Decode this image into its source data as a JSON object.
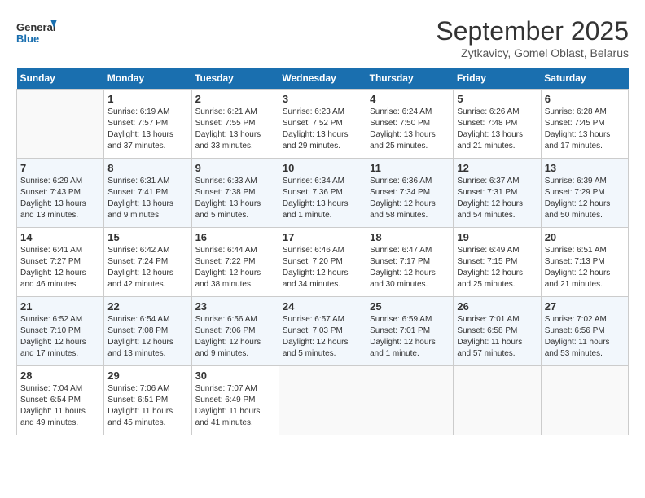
{
  "header": {
    "logo_line1": "General",
    "logo_line2": "Blue",
    "title": "September 2025",
    "subtitle": "Zytkavicy, Gomel Oblast, Belarus"
  },
  "weekdays": [
    "Sunday",
    "Monday",
    "Tuesday",
    "Wednesday",
    "Thursday",
    "Friday",
    "Saturday"
  ],
  "weeks": [
    [
      {
        "day": "",
        "info": ""
      },
      {
        "day": "1",
        "info": "Sunrise: 6:19 AM\nSunset: 7:57 PM\nDaylight: 13 hours\nand 37 minutes."
      },
      {
        "day": "2",
        "info": "Sunrise: 6:21 AM\nSunset: 7:55 PM\nDaylight: 13 hours\nand 33 minutes."
      },
      {
        "day": "3",
        "info": "Sunrise: 6:23 AM\nSunset: 7:52 PM\nDaylight: 13 hours\nand 29 minutes."
      },
      {
        "day": "4",
        "info": "Sunrise: 6:24 AM\nSunset: 7:50 PM\nDaylight: 13 hours\nand 25 minutes."
      },
      {
        "day": "5",
        "info": "Sunrise: 6:26 AM\nSunset: 7:48 PM\nDaylight: 13 hours\nand 21 minutes."
      },
      {
        "day": "6",
        "info": "Sunrise: 6:28 AM\nSunset: 7:45 PM\nDaylight: 13 hours\nand 17 minutes."
      }
    ],
    [
      {
        "day": "7",
        "info": "Sunrise: 6:29 AM\nSunset: 7:43 PM\nDaylight: 13 hours\nand 13 minutes."
      },
      {
        "day": "8",
        "info": "Sunrise: 6:31 AM\nSunset: 7:41 PM\nDaylight: 13 hours\nand 9 minutes."
      },
      {
        "day": "9",
        "info": "Sunrise: 6:33 AM\nSunset: 7:38 PM\nDaylight: 13 hours\nand 5 minutes."
      },
      {
        "day": "10",
        "info": "Sunrise: 6:34 AM\nSunset: 7:36 PM\nDaylight: 13 hours\nand 1 minute."
      },
      {
        "day": "11",
        "info": "Sunrise: 6:36 AM\nSunset: 7:34 PM\nDaylight: 12 hours\nand 58 minutes."
      },
      {
        "day": "12",
        "info": "Sunrise: 6:37 AM\nSunset: 7:31 PM\nDaylight: 12 hours\nand 54 minutes."
      },
      {
        "day": "13",
        "info": "Sunrise: 6:39 AM\nSunset: 7:29 PM\nDaylight: 12 hours\nand 50 minutes."
      }
    ],
    [
      {
        "day": "14",
        "info": "Sunrise: 6:41 AM\nSunset: 7:27 PM\nDaylight: 12 hours\nand 46 minutes."
      },
      {
        "day": "15",
        "info": "Sunrise: 6:42 AM\nSunset: 7:24 PM\nDaylight: 12 hours\nand 42 minutes."
      },
      {
        "day": "16",
        "info": "Sunrise: 6:44 AM\nSunset: 7:22 PM\nDaylight: 12 hours\nand 38 minutes."
      },
      {
        "day": "17",
        "info": "Sunrise: 6:46 AM\nSunset: 7:20 PM\nDaylight: 12 hours\nand 34 minutes."
      },
      {
        "day": "18",
        "info": "Sunrise: 6:47 AM\nSunset: 7:17 PM\nDaylight: 12 hours\nand 30 minutes."
      },
      {
        "day": "19",
        "info": "Sunrise: 6:49 AM\nSunset: 7:15 PM\nDaylight: 12 hours\nand 25 minutes."
      },
      {
        "day": "20",
        "info": "Sunrise: 6:51 AM\nSunset: 7:13 PM\nDaylight: 12 hours\nand 21 minutes."
      }
    ],
    [
      {
        "day": "21",
        "info": "Sunrise: 6:52 AM\nSunset: 7:10 PM\nDaylight: 12 hours\nand 17 minutes."
      },
      {
        "day": "22",
        "info": "Sunrise: 6:54 AM\nSunset: 7:08 PM\nDaylight: 12 hours\nand 13 minutes."
      },
      {
        "day": "23",
        "info": "Sunrise: 6:56 AM\nSunset: 7:06 PM\nDaylight: 12 hours\nand 9 minutes."
      },
      {
        "day": "24",
        "info": "Sunrise: 6:57 AM\nSunset: 7:03 PM\nDaylight: 12 hours\nand 5 minutes."
      },
      {
        "day": "25",
        "info": "Sunrise: 6:59 AM\nSunset: 7:01 PM\nDaylight: 12 hours\nand 1 minute."
      },
      {
        "day": "26",
        "info": "Sunrise: 7:01 AM\nSunset: 6:58 PM\nDaylight: 11 hours\nand 57 minutes."
      },
      {
        "day": "27",
        "info": "Sunrise: 7:02 AM\nSunset: 6:56 PM\nDaylight: 11 hours\nand 53 minutes."
      }
    ],
    [
      {
        "day": "28",
        "info": "Sunrise: 7:04 AM\nSunset: 6:54 PM\nDaylight: 11 hours\nand 49 minutes."
      },
      {
        "day": "29",
        "info": "Sunrise: 7:06 AM\nSunset: 6:51 PM\nDaylight: 11 hours\nand 45 minutes."
      },
      {
        "day": "30",
        "info": "Sunrise: 7:07 AM\nSunset: 6:49 PM\nDaylight: 11 hours\nand 41 minutes."
      },
      {
        "day": "",
        "info": ""
      },
      {
        "day": "",
        "info": ""
      },
      {
        "day": "",
        "info": ""
      },
      {
        "day": "",
        "info": ""
      }
    ]
  ]
}
